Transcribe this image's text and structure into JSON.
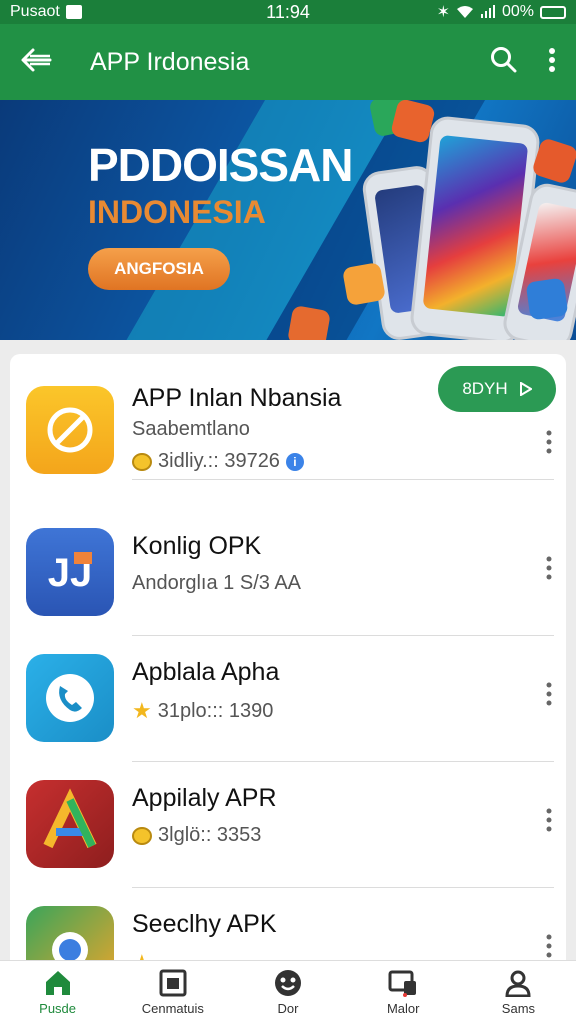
{
  "status_bar": {
    "carrier": "Pusaot",
    "time": "11:94",
    "battery": "00%"
  },
  "app_bar": {
    "title": "APP Irdonesia",
    "back_icon": "arrow-left-icon",
    "search_icon": "search-icon",
    "more_icon": "more-vertical-icon"
  },
  "banner": {
    "headline": "PDDOISSAN",
    "subheadline": "INDONESIA",
    "cta_label": "ANGFOSIA"
  },
  "apps": [
    {
      "name": "APP Inlan Nbansia",
      "subtitle": "Saabemtlano",
      "meta": "3idliy.:: 39726",
      "badge": "emoji",
      "install_label": "8DYH"
    },
    {
      "name": "Konlig OPK",
      "subtitle": "Andorglıa  1 S/3 AA",
      "meta": "",
      "badge": "none"
    },
    {
      "name": "Apblala Apha",
      "subtitle": "",
      "meta": "31plo::: 1390",
      "badge": "star"
    },
    {
      "name": "Appilaly APR",
      "subtitle": "",
      "meta": "3lglö:: 3353",
      "badge": "emoji"
    },
    {
      "name": "Seeclhy APK",
      "subtitle": "",
      "meta": "",
      "badge": "star"
    }
  ],
  "bottom_nav": [
    {
      "label": "Pusde",
      "icon": "home-icon",
      "active": true
    },
    {
      "label": "Cenmatuis",
      "icon": "gallery-icon",
      "active": false
    },
    {
      "label": "Dor",
      "icon": "smiley-icon",
      "active": false
    },
    {
      "label": "Malor",
      "icon": "tablet-icon",
      "active": false
    },
    {
      "label": "Sams",
      "icon": "person-icon",
      "active": false
    }
  ],
  "colors": {
    "primary": "#219145",
    "status": "#1b7f3a",
    "accent": "#2b9a54",
    "active_nav": "#1f8a3c"
  }
}
